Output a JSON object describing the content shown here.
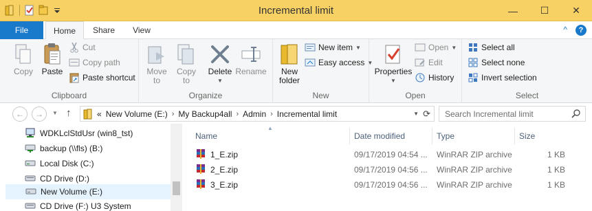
{
  "window": {
    "title": "Incremental limit",
    "minimize": "—",
    "maximize": "☐",
    "close": "✕"
  },
  "tabs": {
    "file": "File",
    "home": "Home",
    "share": "Share",
    "view": "View",
    "help": "?",
    "collapse": "^"
  },
  "ribbon": {
    "clipboard": {
      "label": "Clipboard",
      "copy": "Copy",
      "paste": "Paste",
      "cut": "Cut",
      "copy_path": "Copy path",
      "paste_shortcut": "Paste shortcut"
    },
    "organize": {
      "label": "Organize",
      "move_to": "Move\nto",
      "copy_to": "Copy\nto",
      "delete": "Delete",
      "rename": "Rename"
    },
    "new": {
      "label": "New",
      "new_folder": "New\nfolder",
      "new_item": "New item",
      "easy_access": "Easy access"
    },
    "open": {
      "label": "Open",
      "properties": "Properties",
      "open": "Open",
      "edit": "Edit",
      "history": "History"
    },
    "select": {
      "label": "Select",
      "select_all": "Select all",
      "select_none": "Select none",
      "invert_selection": "Invert selection"
    }
  },
  "address": {
    "prefix": "«",
    "crumbs": [
      "New Volume (E:)",
      "My Backup4all",
      "Admin",
      "Incremental limit"
    ],
    "search_placeholder": "Search Incremental limit"
  },
  "nav_pane": {
    "items": [
      {
        "label": "WDKLclStdUsr (win8_tst)",
        "icon": "network-computer-icon"
      },
      {
        "label": "backup (\\\\fls) (B:)",
        "icon": "network-drive-icon"
      },
      {
        "label": "Local Disk (C:)",
        "icon": "hard-drive-icon"
      },
      {
        "label": "CD Drive (D:)",
        "icon": "cd-drive-icon"
      },
      {
        "label": "New Volume (E:)",
        "icon": "hard-drive-icon",
        "selected": true
      },
      {
        "label": "CD Drive (F:) U3 System",
        "icon": "cd-drive-icon"
      }
    ]
  },
  "file_list": {
    "columns": {
      "name": "Name",
      "date_modified": "Date modified",
      "type": "Type",
      "size": "Size"
    },
    "rows": [
      {
        "name": "1_E.zip",
        "date": "09/17/2019 04:54 ...",
        "type": "WinRAR ZIP archive",
        "size": "1 KB"
      },
      {
        "name": "2_E.zip",
        "date": "09/17/2019 04:56 ...",
        "type": "WinRAR ZIP archive",
        "size": "1 KB"
      },
      {
        "name": "3_E.zip",
        "date": "09/17/2019 04:56 ...",
        "type": "WinRAR ZIP archive",
        "size": "1 KB"
      }
    ]
  },
  "colors": {
    "titlebar": "#f8d164",
    "file_tab": "#1979ca",
    "selection": "#e5f3ff"
  }
}
